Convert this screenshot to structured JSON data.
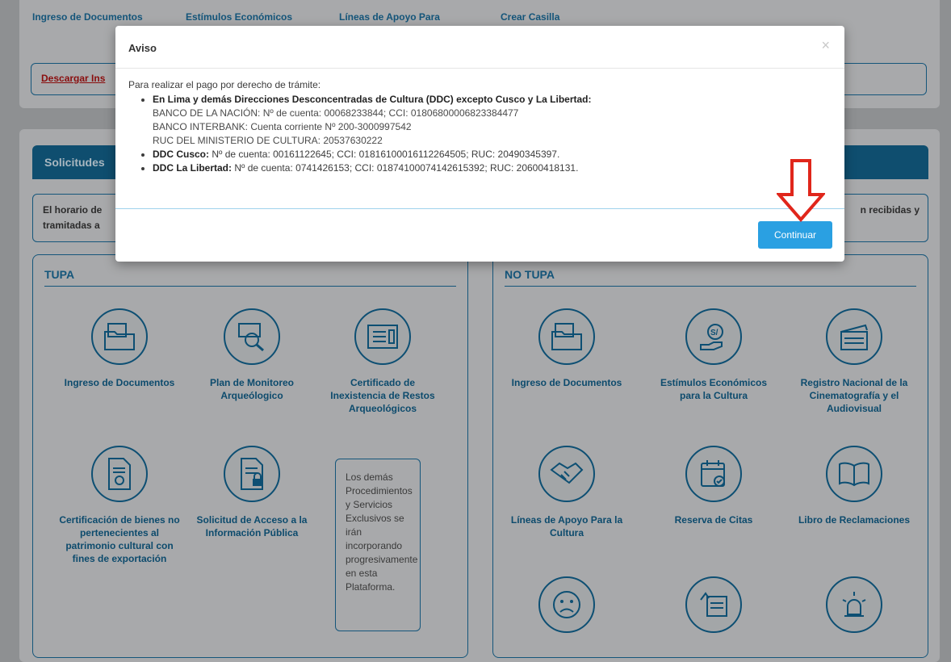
{
  "top_nav": {
    "items": [
      "Ingreso de Documentos",
      "Estímulos Económicos",
      "Líneas de Apoyo Para",
      "Crear Casilla"
    ],
    "download_link": "Descargar Ins"
  },
  "solicitudes": {
    "title": "Solicitudes",
    "horario_line1": "El horario de",
    "horario_line2": "tramitadas a",
    "horario_right": "n recibidas y"
  },
  "tupa": {
    "title": "TUPA",
    "tiles": [
      {
        "label": "Ingreso de Documentos",
        "icon": "folder-icon"
      },
      {
        "label": "Plan de Monitoreo Arqueólogico",
        "icon": "archaeology-search-icon"
      },
      {
        "label": "Certificado de Inexistencia de Restos Arqueológicos",
        "icon": "certificate-icon"
      },
      {
        "label": "Certificación de bienes no pertenecientes al patrimonio cultural con fines de exportación",
        "icon": "award-document-icon"
      },
      {
        "label": "Solicitud de Acceso a la Información Pública",
        "icon": "locked-document-icon"
      }
    ],
    "notice": "Los demás Procedimientos y Servicios Exclusivos se irán incorporando progresivamente en esta Plataforma."
  },
  "no_tupa": {
    "title": "NO TUPA",
    "tiles": [
      {
        "label": "Ingreso de Documentos",
        "icon": "folder-icon"
      },
      {
        "label": "Estímulos Económicos para la Cultura",
        "icon": "money-hand-icon"
      },
      {
        "label": "Registro Nacional de la Cinematografía y el Audiovisual",
        "icon": "clapperboard-icon"
      },
      {
        "label": "Líneas de Apoyo Para la Cultura",
        "icon": "handshake-icon"
      },
      {
        "label": "Reserva de Citas",
        "icon": "calendar-check-icon"
      },
      {
        "label": "Libro de Reclamaciones",
        "icon": "book-icon"
      },
      {
        "label": "",
        "icon": "sad-face-icon"
      },
      {
        "label": "",
        "icon": "form-hand-icon"
      },
      {
        "label": "",
        "icon": "alarm-light-icon"
      }
    ]
  },
  "modal": {
    "title": "Aviso",
    "close_glyph": "×",
    "intro": "Para realizar el pago por derecho de trámite:",
    "lima_heading": "En Lima y demás Direcciones Desconcentradas de Cultura (DDC) excepto Cusco y La Libertad:",
    "lima_lines": [
      "BANCO DE LA NACIÓN: Nº de cuenta: 00068233844; CCI: 01806800006823384477",
      "BANCO INTERBANK: Cuenta corriente Nº 200-3000997542",
      "RUC DEL MINISTERIO DE CULTURA: 20537630222"
    ],
    "cusco_label": "DDC Cusco:",
    "cusco_text": " Nº de cuenta: 00161122645; CCI: 01816100016112264505; RUC: 20490345397.",
    "libertad_label": "DDC La Libertad:",
    "libertad_text": " Nº de cuenta: 0741426153; CCI: 01874100074142615392; RUC: 20600418131.",
    "continue_label": "Continuar"
  },
  "colors": {
    "overlay": "#8e9092",
    "brand_blue": "#15567b",
    "button_blue": "#2aa0e2",
    "arrow_red": "#e0261b"
  }
}
